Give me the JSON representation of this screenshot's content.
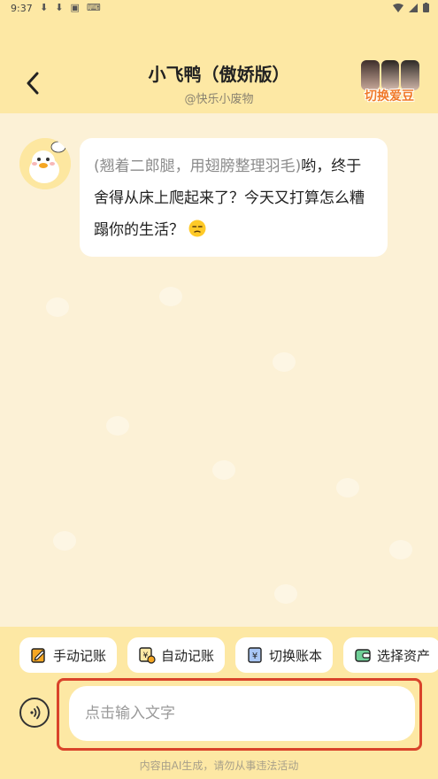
{
  "statusbar": {
    "time": "9:37"
  },
  "header": {
    "title": "小飞鸭（傲娇版）",
    "subtitle": "@快乐小废物",
    "switch_idol_label": "切换爱豆"
  },
  "chat": {
    "message": {
      "action": "(翘着二郎腿，用翅膀整理羽毛)",
      "text": "哟，终于舍得从床上爬起来了？今天又打算怎么糟蹋你的生活？"
    }
  },
  "chips": [
    {
      "label": "手动记账",
      "icon": "edit-note-icon"
    },
    {
      "label": "自动记账",
      "icon": "auto-yen-icon"
    },
    {
      "label": "切换账本",
      "icon": "yen-book-icon"
    },
    {
      "label": "选择资产",
      "icon": "wallet-icon"
    }
  ],
  "input": {
    "placeholder": "点击输入文字"
  },
  "disclaimer": "内容由AI生成，请勿从事违法活动",
  "colors": {
    "header_bg": "#FDE8A4",
    "page_bg": "#FCF1D6",
    "highlight_border": "#D9432A",
    "accent_orange": "#F07A2A"
  }
}
